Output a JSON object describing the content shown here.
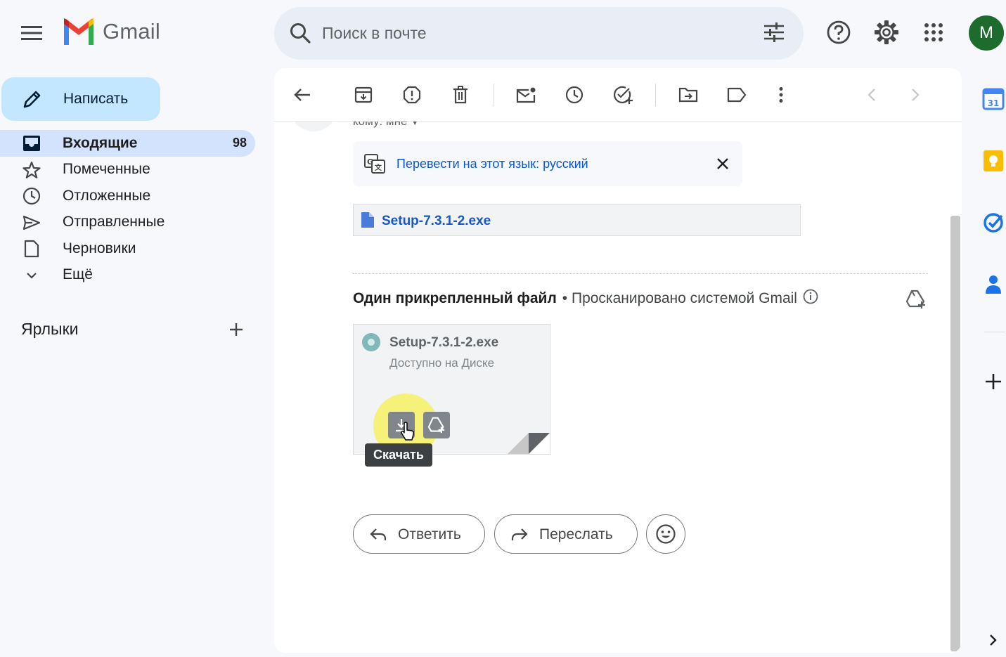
{
  "app": {
    "name": "Gmail",
    "avatar_letter": "M"
  },
  "search": {
    "placeholder": "Поиск в почте"
  },
  "compose": {
    "label": "Написать"
  },
  "nav": [
    {
      "label": "Входящие",
      "count": "98",
      "icon": "inbox-icon",
      "active": true
    },
    {
      "label": "Помеченные",
      "icon": "star-icon"
    },
    {
      "label": "Отложенные",
      "icon": "clock-icon"
    },
    {
      "label": "Отправленные",
      "icon": "send-icon"
    },
    {
      "label": "Черновики",
      "icon": "draft-icon"
    },
    {
      "label": "Ещё",
      "icon": "chevron-down-icon"
    }
  ],
  "labels": {
    "heading": "Ярлыки"
  },
  "message": {
    "to_line": "кому: мне",
    "translate_link": "Перевести на этот язык: русский",
    "inline_file": "Setup-7.3.1-2.exe",
    "attachments_title": "Один прикрепленный файл",
    "attachments_scan": "• Просканировано системой Gmail",
    "attachment": {
      "name": "Setup-7.3.1-2.exe",
      "sub": "Доступно на Диске"
    },
    "tooltip": "Скачать",
    "reply_label": "Ответить",
    "forward_label": "Переслать"
  },
  "side_rail": {
    "calendar_day": "31"
  },
  "colors": {
    "accent": "#0b57d0",
    "compose_bg": "#c2e7ff",
    "active_nav_bg": "#d3e3fd",
    "avatar_bg": "#1e6b2e"
  }
}
